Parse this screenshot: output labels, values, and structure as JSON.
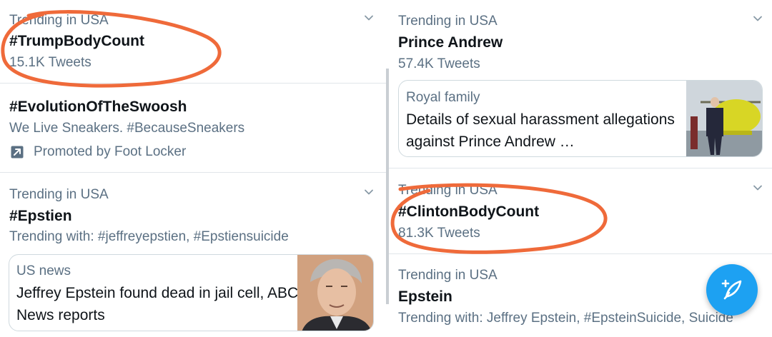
{
  "left_column": {
    "trend_1": {
      "context": "Trending in USA",
      "title": "#TrumpBodyCount",
      "meta": "15.1K Tweets"
    },
    "promoted": {
      "title": "#EvolutionOfTheSwoosh",
      "description": "We Live Sneakers. #BecauseSneakers",
      "promoted_by": "Promoted by Foot Locker",
      "icon": "promoted-arrow-icon"
    },
    "trend_2": {
      "context": "Trending in USA",
      "title": "#Epstien",
      "meta": "Trending with: #jeffreyepstien, #Epstiensuicide",
      "card": {
        "topic": "US news",
        "title": "Jeffrey Epstein found dead in jail cell, ABC News reports"
      }
    }
  },
  "right_column": {
    "trend_1": {
      "context": "Trending in USA",
      "title": "Prince Andrew",
      "meta": "57.4K Tweets",
      "card": {
        "topic": "Royal family",
        "title": "Details of sexual harassment allegations against Prince Andrew …"
      }
    },
    "trend_2": {
      "context": "Trending in USA",
      "title": "#ClintonBodyCount",
      "meta": "81.3K Tweets"
    },
    "trend_3": {
      "context": "Trending in USA",
      "title": "Epstein",
      "meta": "Trending with: Jeffrey Epstein, #EpsteinSuicide, Suicide"
    }
  },
  "compose_button": {
    "icon": "compose-feather-icon"
  },
  "colors": {
    "text_primary": "#0f1419",
    "text_secondary": "#5b7083",
    "accent": "#1da1f2",
    "annotation": "#ef6a3a",
    "divider": "#e1e6ea"
  }
}
